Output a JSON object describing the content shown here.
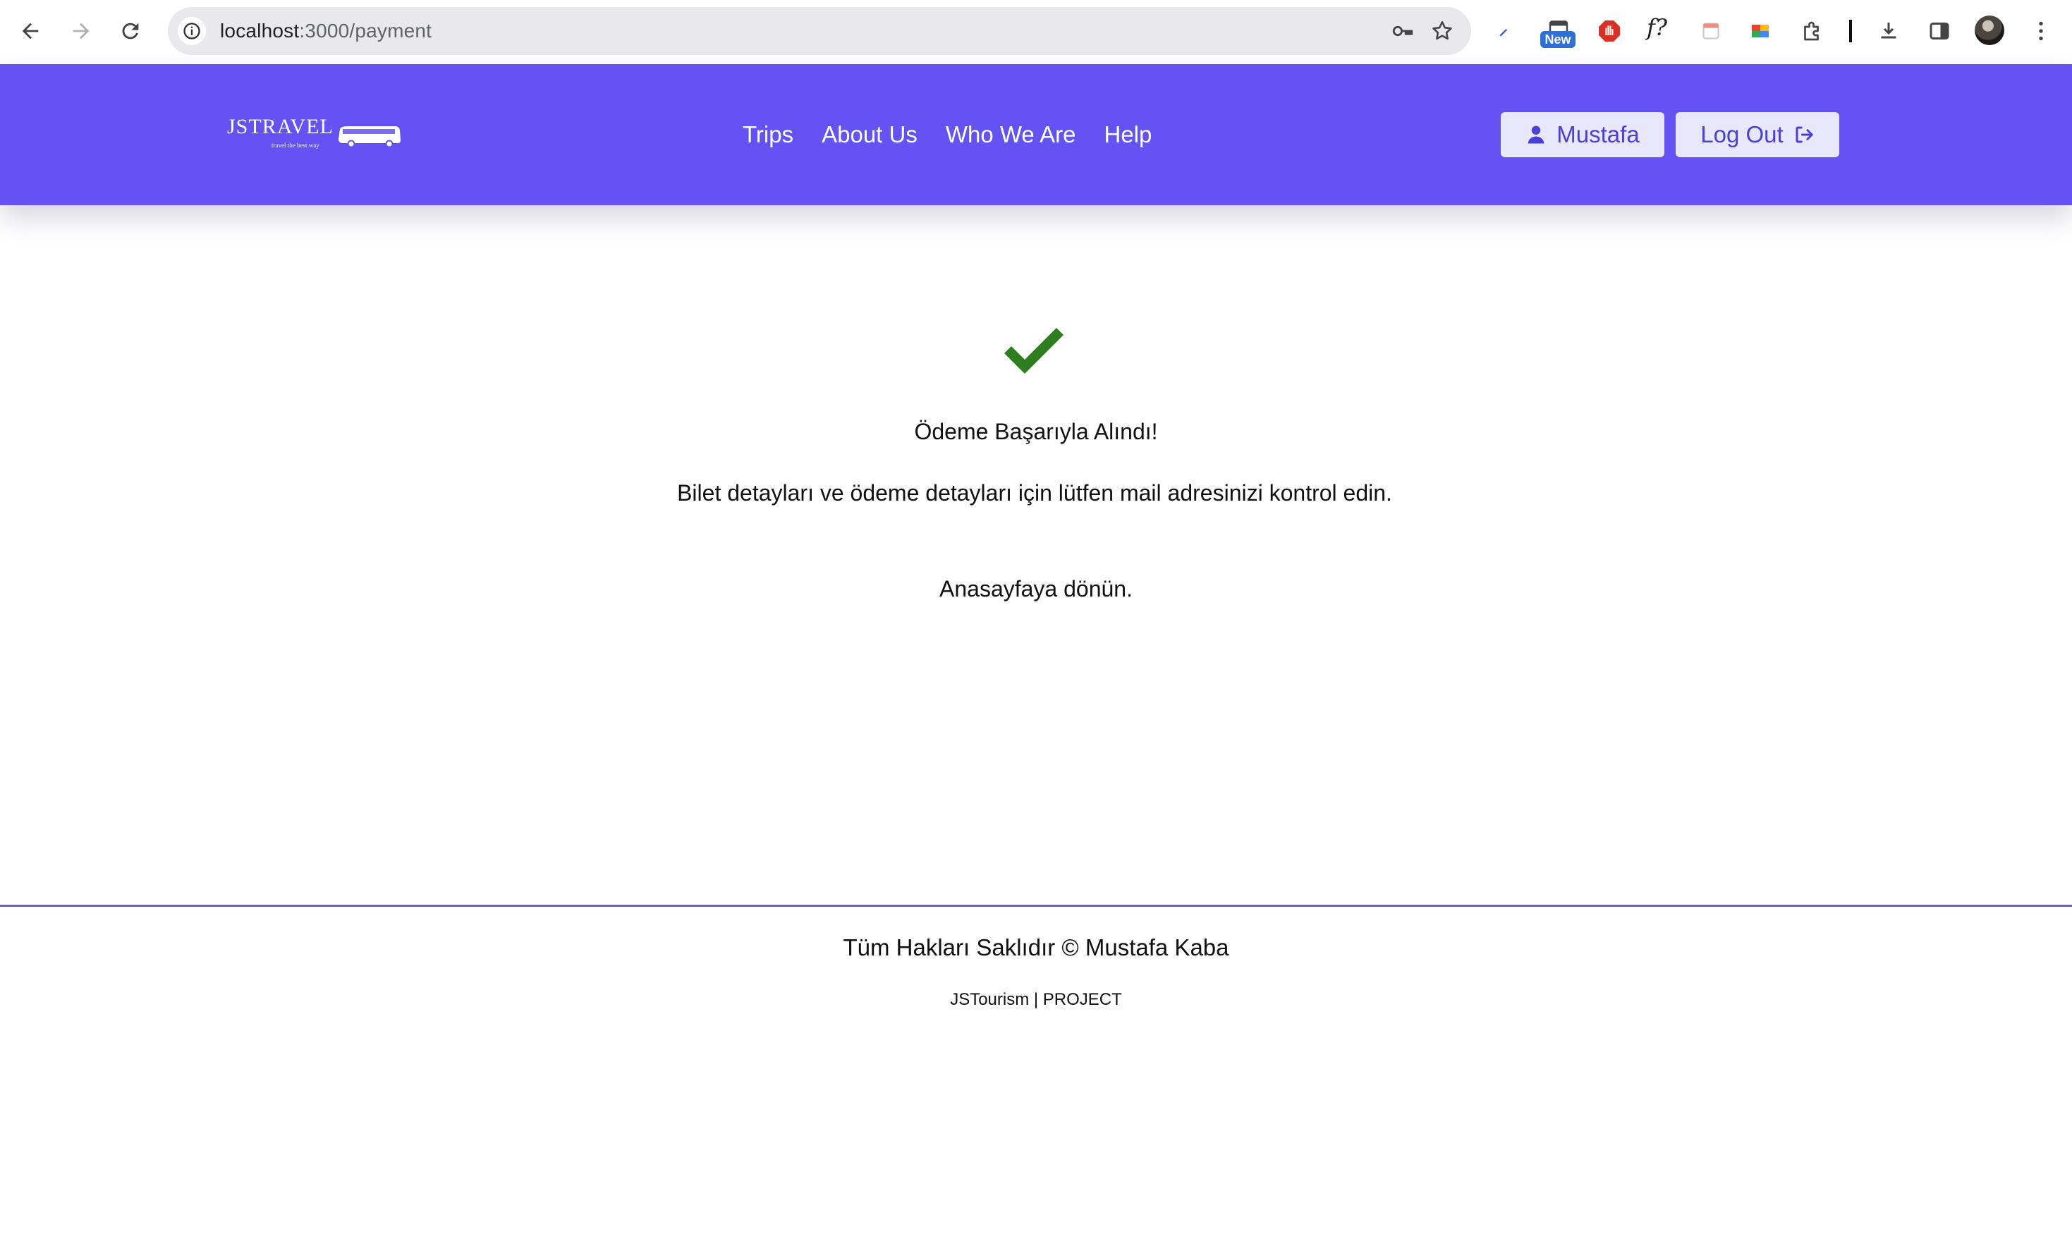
{
  "browser": {
    "url_host": "localhost",
    "url_path": ":3000/payment",
    "new_badge": "New",
    "func_ext_label": "f?"
  },
  "header": {
    "logo_text": "JSTRAVEL",
    "logo_tagline": "travel the best way",
    "nav": [
      "Trips",
      "About Us",
      "Who We Are",
      "Help"
    ],
    "user_label": "Mustafa",
    "logout_label": "Log Out"
  },
  "content": {
    "success_title": "Ödeme Başarıyla Alındı!",
    "details_text": "Bilet detayları ve ödeme detayları için lütfen mail adresinizi kontrol edin.",
    "home_link": "Anasayfaya dönün."
  },
  "footer": {
    "copyright": "Tüm Hakları Saklıdır © Mustafa Kaba",
    "project": "JSTourism | PROJECT"
  },
  "colors": {
    "header_bg": "#6452f5",
    "button_bg": "#e9e7fb",
    "button_text": "#4c3fd9",
    "success_green": "#2e7d1e",
    "footer_line": "#6b5fc9"
  },
  "icons": {
    "back": "arrow-left-icon",
    "forward": "arrow-right-icon",
    "reload": "reload-icon",
    "site_info": "info-icon",
    "password": "key-icon",
    "bookmark": "star-icon",
    "extensions": "puzzle-icon",
    "download": "download-icon",
    "side_panel": "side-panel-icon",
    "menu": "kebab-menu-icon",
    "user": "user-icon",
    "logout": "logout-icon",
    "success": "checkmark-icon"
  }
}
